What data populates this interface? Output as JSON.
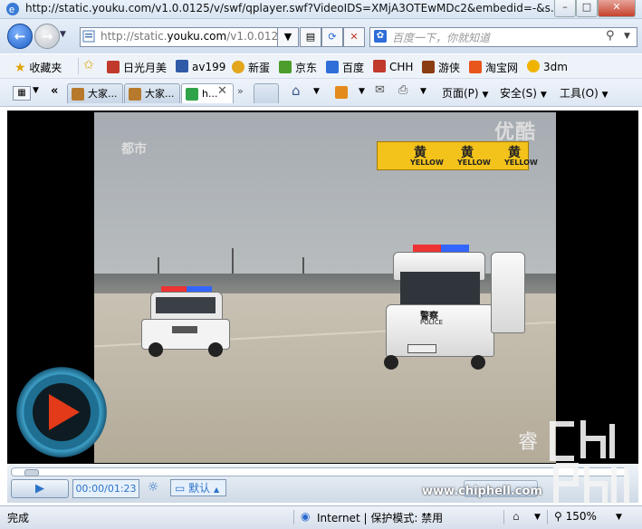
{
  "window": {
    "title": "http://static.youku.com/v1.0.0125/v/swf/qplayer.swf?VideoIDS=XMjA3OTEwMDc2&embedid=-&s...",
    "controls": [
      "minimize-icon",
      "maximize-icon",
      "close-icon"
    ]
  },
  "address_bar": {
    "url_prefix": "http://static.",
    "url_domain": "youku.com",
    "url_suffix": "/v1.0.0125/",
    "search_placeholder": "百度一下，你就知道"
  },
  "favorites_bar": {
    "favorites_label": "收藏夹",
    "items": [
      {
        "label": "日光月美",
        "icon": "bookmark-icon",
        "color": "#c0392b"
      },
      {
        "label": "av199",
        "icon": "hd-icon",
        "color": "#2e5aa8"
      },
      {
        "label": "新蛋",
        "icon": "egg-icon",
        "color": "#e3a51b"
      },
      {
        "label": "京东",
        "icon": "jd-icon",
        "color": "#4b9e2b"
      },
      {
        "label": "百度",
        "icon": "paw-icon",
        "color": "#2f6ed8"
      },
      {
        "label": "CHH",
        "icon": "chh-icon",
        "color": "#c0392b"
      },
      {
        "label": "游侠",
        "icon": "ali-icon",
        "color": "#8b3d12"
      },
      {
        "label": "淘宝网",
        "icon": "taobao-icon",
        "color": "#e8561c"
      },
      {
        "label": "3dm",
        "icon": "3dm-icon",
        "color": "#f0b400"
      }
    ]
  },
  "tab_bar": {
    "tabs": [
      {
        "label": "大家...",
        "active": false
      },
      {
        "label": "大家...",
        "active": false
      },
      {
        "label": "h...",
        "active": true
      }
    ],
    "commands": {
      "page": "页面(P)",
      "safety": "安全(S)",
      "tools": "工具(O)"
    }
  },
  "video": {
    "channel_logo": "都市",
    "site_logo": "优酷",
    "banner": {
      "chars": [
        "黄",
        "黄",
        "黄"
      ],
      "sub": [
        "YELLOW",
        "YELLOW",
        "YELLOW"
      ]
    },
    "corner_text": "睿",
    "van_text": "警察",
    "van_sub": "POLICE"
  },
  "player": {
    "time": "00:00/01:23",
    "quality": "默认",
    "watermark": "www.chiphell.com"
  },
  "status_bar": {
    "status": "完成",
    "zone": "Internet | 保护模式: 禁用",
    "zoom": "150%"
  }
}
